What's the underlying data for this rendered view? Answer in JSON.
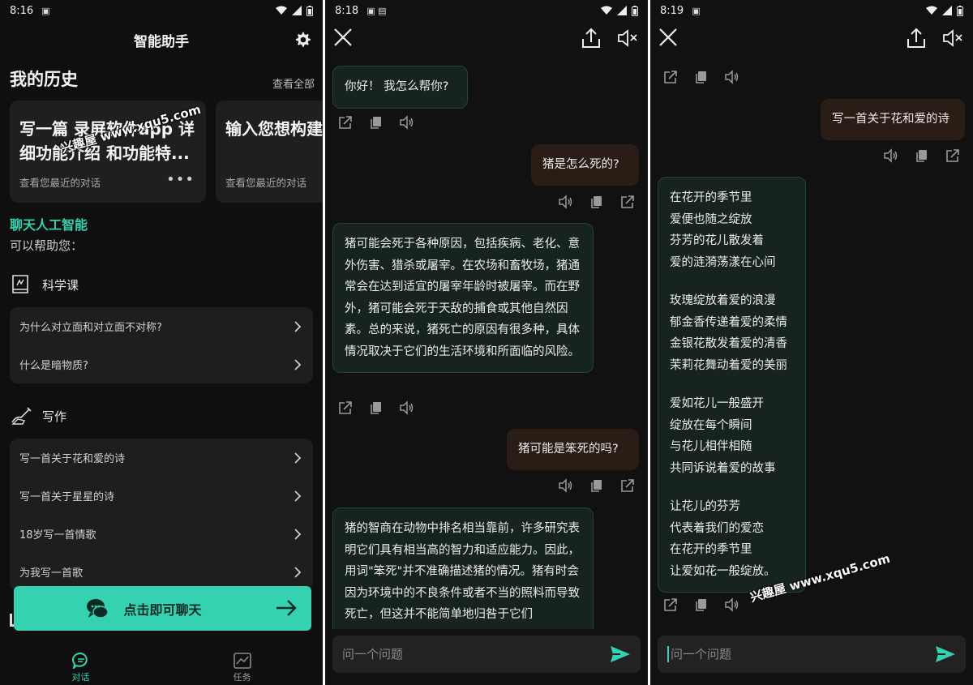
{
  "colors": {
    "accent": "#34d2b0",
    "user_bubble": "#2a1d16",
    "ai_bubble": "#17231f",
    "background": "#0f0f0f"
  },
  "screen1": {
    "status": {
      "time": "8:16"
    },
    "title": "智能助手",
    "history_title": "我的历史",
    "view_all": "查看全部",
    "cards": [
      {
        "title": "写一篇 录屏软件app 详细功能介绍 和功能特...",
        "subtitle": "查看您最近的对话",
        "more": "•••"
      },
      {
        "title": "输入您想构建 本",
        "subtitle": "查看您最近的对话"
      }
    ],
    "ai_label": "聊天人工智能",
    "ai_sub": "可以帮助您：",
    "sections": [
      {
        "label": "科学课",
        "icon": "book-icon",
        "items": [
          "为什么对立面和对立面不对称?",
          "什么是暗物质?"
        ]
      },
      {
        "label": "写作",
        "icon": "writing-hand-icon",
        "items": [
          "写一首关于花和爱的诗",
          "写一首关于星星的诗",
          "18岁写一首情歌",
          "为我写一首歌"
        ]
      }
    ],
    "chat_button": "点击即可聊天",
    "nav": [
      {
        "label": "对话",
        "icon": "chat-icon",
        "active": true
      },
      {
        "label": "任务",
        "icon": "chart-icon",
        "active": false
      }
    ]
  },
  "screen2": {
    "status": {
      "time": "8:18"
    },
    "messages": [
      {
        "role": "ai",
        "text": "你好！ 我怎么帮你?"
      },
      {
        "role": "user",
        "text": "猪是怎么死的?"
      },
      {
        "role": "ai",
        "text": "猪可能会死于各种原因，包括疾病、老化、意外伤害、猎杀或屠宰。在农场和畜牧场，猪通常会在达到适宜的屠宰年龄时被屠宰。而在野外，猪可能会死于天敌的捕食或其他自然因素。总的来说，猪死亡的原因有很多种，具体情况取决于它们的生活环境和所面临的风险。"
      },
      {
        "role": "user",
        "text": "猪可能是笨死的吗?"
      },
      {
        "role": "ai",
        "text": "猪的智商在动物中排名相当靠前，许多研究表明它们具有相当高的智力和适应能力。因此，用词\"笨死\"并不准确描述猪的情况。猪有时会因为环境中的不良条件或者不当的照料而导致死亡，但这并不能简单地归咎于它们"
      }
    ],
    "input_placeholder": "问一个问题"
  },
  "screen3": {
    "status": {
      "time": "8:19"
    },
    "user_message": "写一首关于花和爱的诗",
    "poem": [
      [
        "在花开的季节里",
        "爱便也随之绽放",
        "芬芳的花儿散发着",
        "爱的涟漪荡漾在心间"
      ],
      [
        "玫瑰绽放着爱的浪漫",
        "郁金香传递着爱的柔情",
        "金银花散发着爱的清香",
        "茉莉花舞动着爱的美丽"
      ],
      [
        "爱如花儿一般盛开",
        "绽放在每个瞬间",
        "与花儿相伴相随",
        "共同诉说着爱的故事"
      ],
      [
        "让花儿的芬芳",
        "代表着我们的爱恋",
        "在花开的季节里",
        "让爱如花一般绽放。"
      ]
    ],
    "input_placeholder": "问一个问题"
  },
  "watermark": "兴趣屋 www.xqu5.com"
}
